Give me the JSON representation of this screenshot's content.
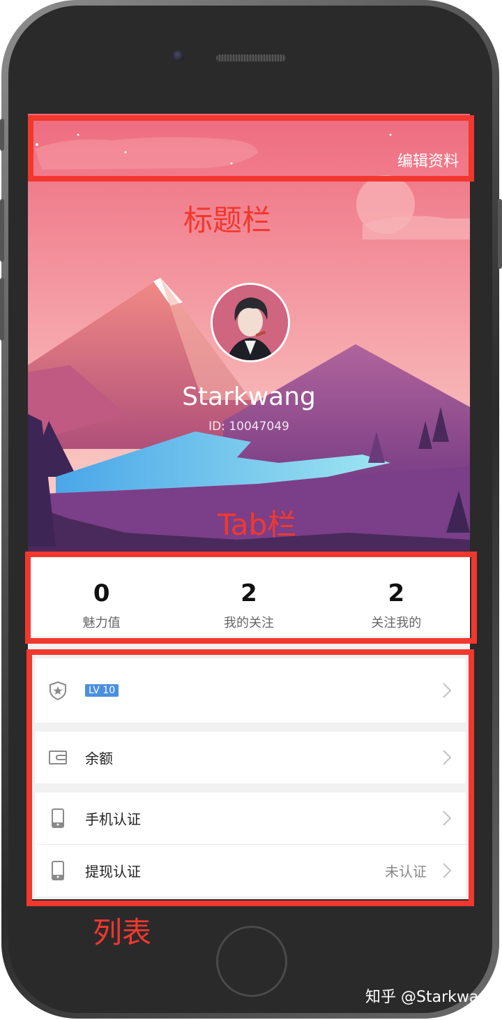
{
  "profile": {
    "edit_label": "编辑资料",
    "username": "Starkwang",
    "user_id": "ID: 10047049"
  },
  "stats": [
    {
      "value": "0",
      "label": "魅力值"
    },
    {
      "value": "2",
      "label": "我的关注"
    },
    {
      "value": "2",
      "label": "关注我的"
    }
  ],
  "list": {
    "level_badge": "LV 10",
    "balance_label": "余额",
    "phone_verify_label": "手机认证",
    "withdraw_verify_label": "提现认证",
    "withdraw_verify_status": "未认证"
  },
  "annotations": {
    "title_bar": "标题栏",
    "tab_bar": "Tab栏",
    "list": "列表"
  },
  "watermark": "知乎 @Starkwang",
  "colors": {
    "annotation_red": "#f2382e",
    "level_badge_blue": "#4a8fe0",
    "sky_top": "#ef6f82",
    "sky_bottom": "#f9c9c4",
    "mountain_purple": "#8a4a8c",
    "river_blue": "#6fd0ef"
  }
}
